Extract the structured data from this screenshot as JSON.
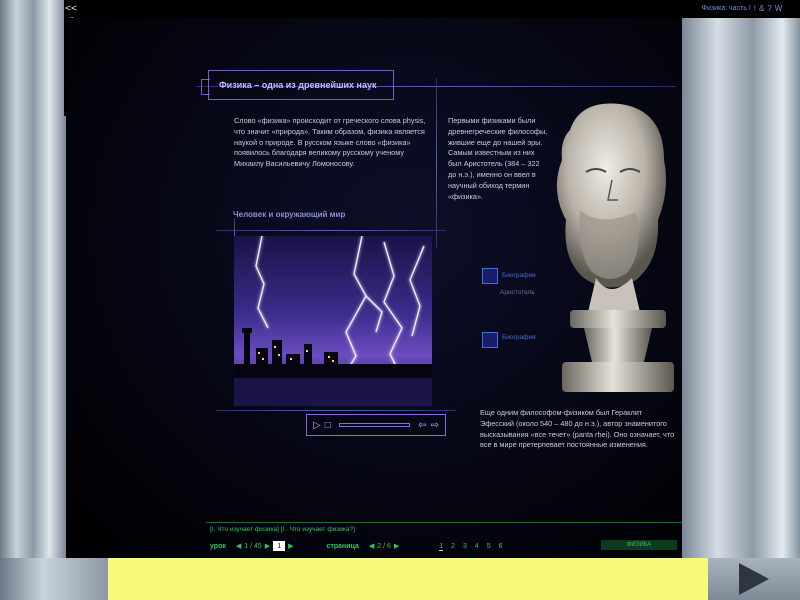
{
  "toolbar": {
    "items": [
      "<<",
      "#",
      "()",
      "^",
      "*",
      "=",
      "o",
      "x"
    ]
  },
  "top_tag": {
    "label": "Физика: часть I",
    "icons": [
      "!",
      "&",
      "?",
      "W"
    ]
  },
  "lesson": {
    "title": "Физика – одна из древнейших наук",
    "intro": "Слово «физика» происходит от греческого слова physis, что значит «природа». Таким образом, физика является наукой о природе. В русском языке слово «физика» появилось благодаря великому русскому ученому Михаилу Васильевичу Ломоносову.",
    "aside": "Первыми физиками были древнегреческие философы, жившие еще до нашей эры. Самым известным из них был Аристотель (384 – 322 до н.э.), именно он ввел в научный обиход термин «физика».",
    "subheading": "Человек и окружающий мир",
    "heraclitus": "Еще одним философом-физиком был Гераклит Эфесский (около 540 – 480 до н.э.), автор знаменитого высказывания «все течет» (panta rhei). Оно означает, что все в мире претерпевает постоянные изменения."
  },
  "bio": [
    {
      "label": "Биография",
      "name": "Аристотель"
    },
    {
      "label": "Биография",
      "name": ""
    }
  ],
  "player": {
    "play": "▷",
    "stop": "□",
    "prev": "⇦",
    "next": "⇨"
  },
  "footer": {
    "breadcrumb": "[I. Что изучает физика] [I . Что изучает физика?]",
    "lesson_label": "урок",
    "lesson_count": "1 / 45",
    "lesson_input": "1",
    "page_label": "страница",
    "page_count": "2 / 6",
    "pages": [
      "1",
      "2",
      "3",
      "4",
      "5",
      "6"
    ],
    "badge": "ФИЗИКА"
  },
  "colors": {
    "accent": "#7a5fc0",
    "nav_green": "#2ec46a",
    "yellow_bar": "#f8f87a"
  }
}
